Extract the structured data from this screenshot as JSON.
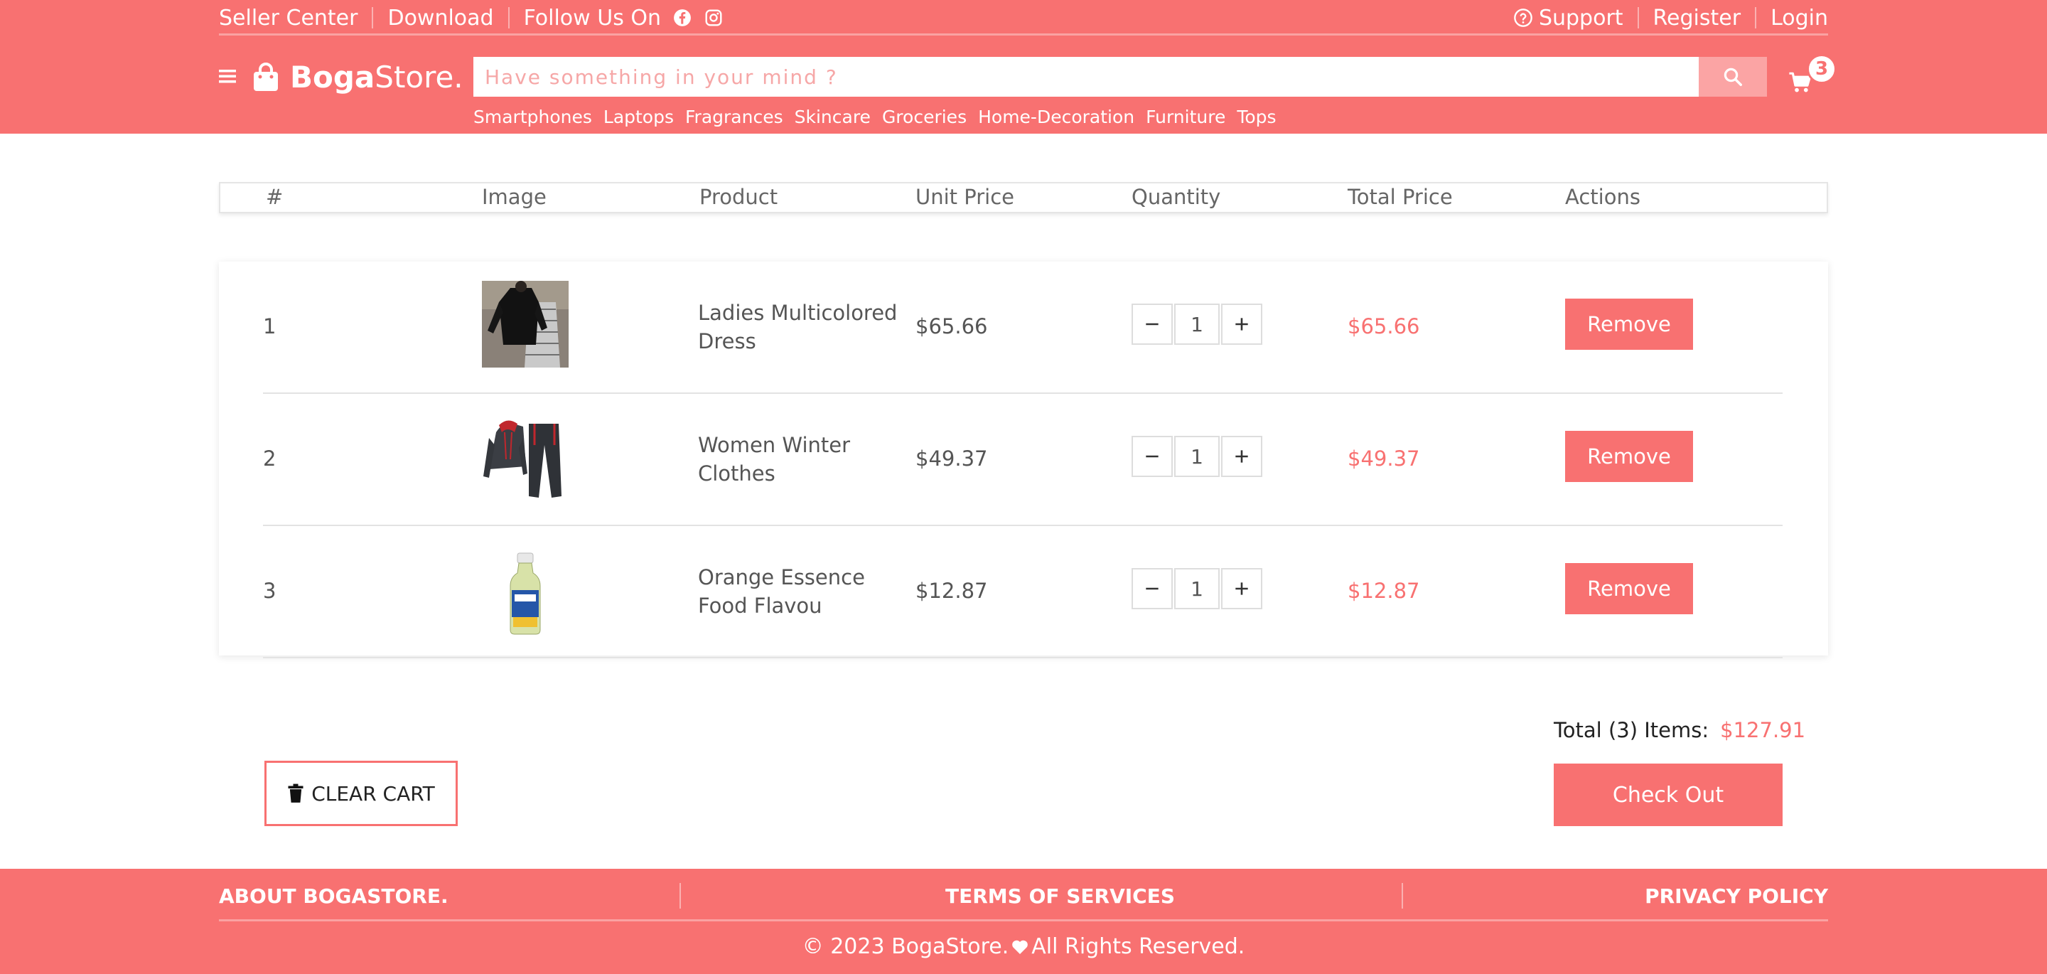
{
  "topbar": {
    "seller_center": "Seller Center",
    "download": "Download",
    "follow_us": "Follow Us On",
    "support": "Support",
    "register": "Register",
    "login": "Login"
  },
  "brand": {
    "bold": "Boga",
    "light": "Store."
  },
  "search": {
    "placeholder": "Have something in your mind ?",
    "value": ""
  },
  "cart": {
    "count": "3"
  },
  "categories": [
    "Smartphones",
    "Laptops",
    "Fragrances",
    "Skincare",
    "Groceries",
    "Home-Decoration",
    "Furniture",
    "Tops"
  ],
  "table": {
    "headers": [
      "#",
      "Image",
      "Product",
      "Unit Price",
      "Quantity",
      "Total Price",
      "Actions"
    ],
    "rows": [
      {
        "num": "1",
        "name": "Ladies Multicolored Dress",
        "unit_price": "$65.66",
        "qty": "1",
        "total": "$65.66",
        "action": "Remove",
        "image": "dress"
      },
      {
        "num": "2",
        "name": "Women Winter Clothes",
        "unit_price": "$49.37",
        "qty": "1",
        "total": "$49.37",
        "action": "Remove",
        "image": "tracksuit"
      },
      {
        "num": "3",
        "name": "Orange Essence Food Flavou",
        "unit_price": "$12.87",
        "qty": "1",
        "total": "$12.87",
        "action": "Remove",
        "image": "bottle"
      }
    ]
  },
  "summary": {
    "clear_label": "CLEAR CART",
    "total_label": "Total (3) Items:",
    "total_value": "$127.91",
    "checkout_label": "Check Out"
  },
  "footer": {
    "about": "ABOUT BOGASTORE.",
    "terms": "TERMS OF SERVICES",
    "privacy": "PRIVACY POLICY",
    "copyright_pre": "© 2023 BogaStore.",
    "copyright_post": "All Rights Reserved."
  },
  "colors": {
    "accent": "#f87171",
    "search_button": "#fba4a4"
  }
}
